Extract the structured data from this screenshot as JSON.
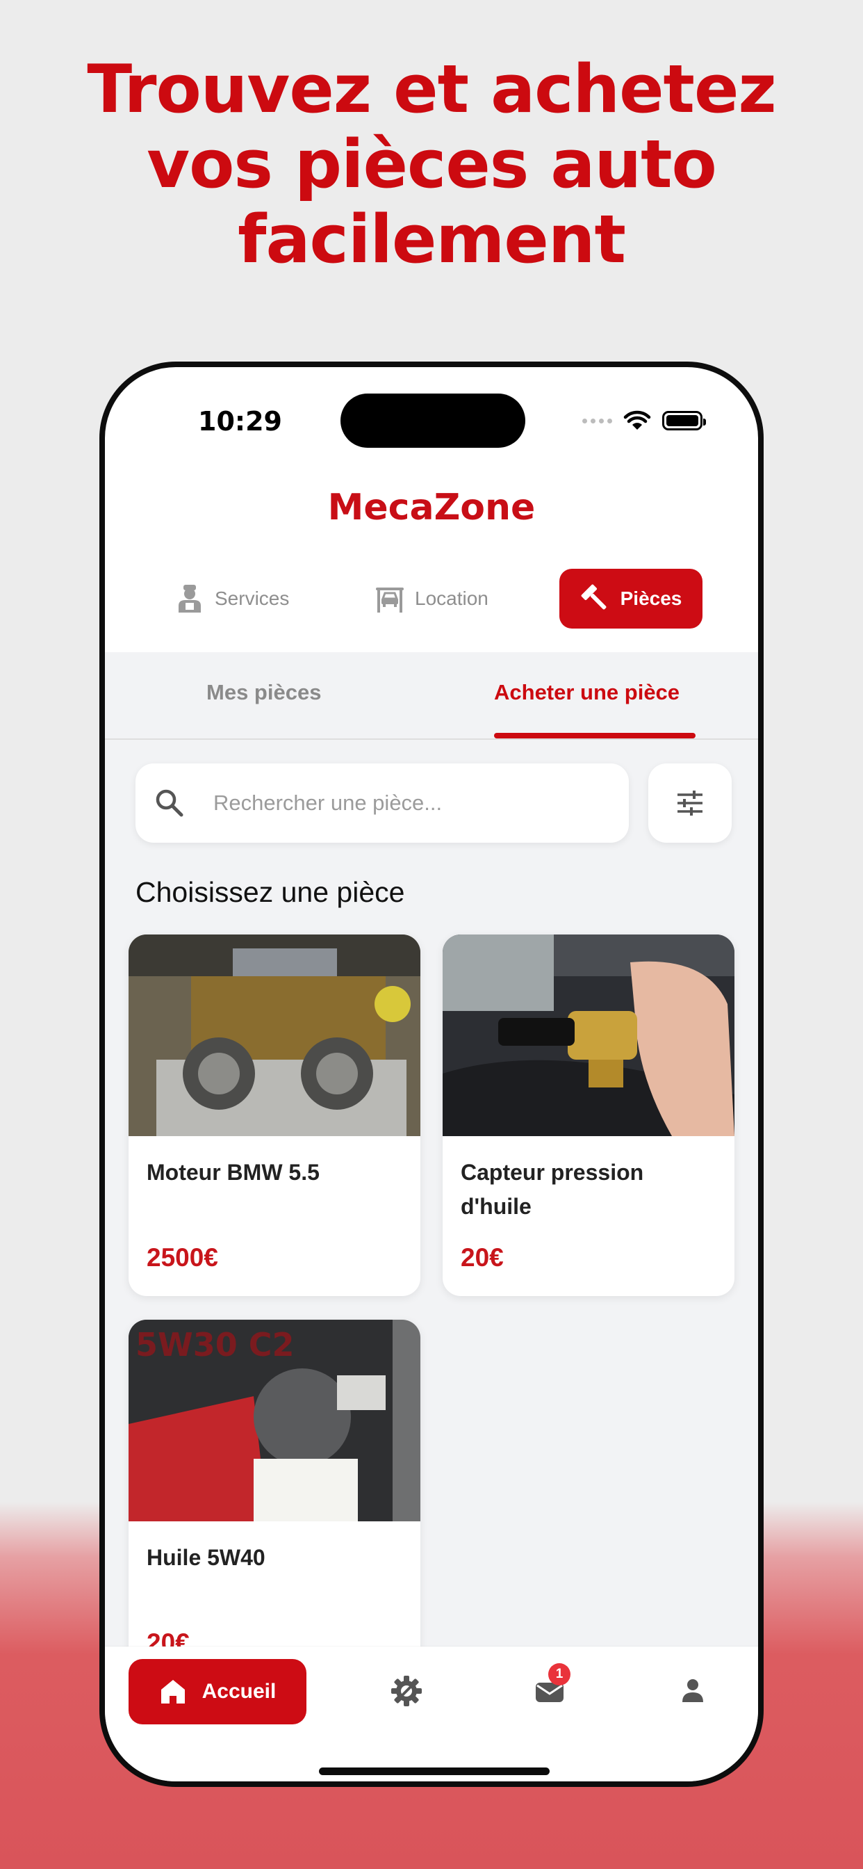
{
  "headline": {
    "line1": "Trouvez et achetez",
    "line2": "vos pièces auto",
    "line3": "facilement"
  },
  "status_bar": {
    "time": "10:29"
  },
  "app": {
    "title": "MecaZone"
  },
  "segments": [
    {
      "label": "Services",
      "icon": "mechanic-icon",
      "active": false
    },
    {
      "label": "Location",
      "icon": "car-lift-icon",
      "active": false
    },
    {
      "label": "Pièces",
      "icon": "hammer-icon",
      "active": true
    }
  ],
  "subtabs": [
    {
      "label": "Mes pièces",
      "active": false
    },
    {
      "label": "Acheter une pièce",
      "active": true
    }
  ],
  "search": {
    "placeholder": "Rechercher une pièce...",
    "value": ""
  },
  "section_title": "Choisissez une pièce",
  "products": [
    {
      "name": "Moteur BMW 5.5",
      "price": "2500€",
      "image": "engine-photo"
    },
    {
      "name": "Capteur pression d'huile",
      "price": "20€",
      "image": "oil-pressure-sensor-photo"
    },
    {
      "name": "Huile 5W40",
      "price": "20€",
      "image": "oil-can-photo",
      "image_text": "5W30 C2"
    }
  ],
  "bottom_nav": {
    "home_label": "Accueil",
    "items": [
      "home-icon",
      "gear-icon",
      "mail-icon",
      "user-icon"
    ],
    "mail_badge": "1"
  },
  "colors": {
    "accent": "#cd0c14",
    "background": "#f2f3f5"
  }
}
